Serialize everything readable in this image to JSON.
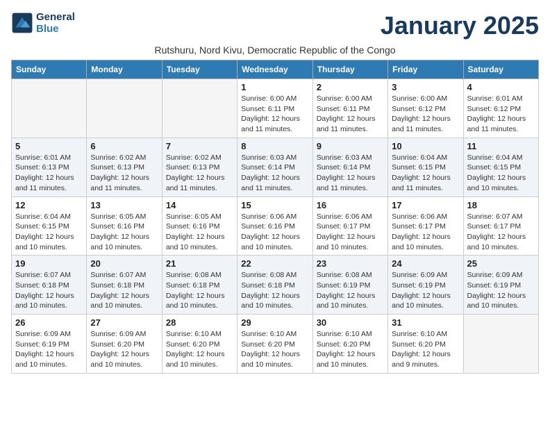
{
  "header": {
    "logo_line1": "General",
    "logo_line2": "Blue",
    "month": "January 2025",
    "subtitle": "Rutshuru, Nord Kivu, Democratic Republic of the Congo"
  },
  "weekdays": [
    "Sunday",
    "Monday",
    "Tuesday",
    "Wednesday",
    "Thursday",
    "Friday",
    "Saturday"
  ],
  "weeks": [
    [
      {
        "day": "",
        "info": ""
      },
      {
        "day": "",
        "info": ""
      },
      {
        "day": "",
        "info": ""
      },
      {
        "day": "1",
        "info": "Sunrise: 6:00 AM\nSunset: 6:11 PM\nDaylight: 12 hours and 11 minutes."
      },
      {
        "day": "2",
        "info": "Sunrise: 6:00 AM\nSunset: 6:11 PM\nDaylight: 12 hours and 11 minutes."
      },
      {
        "day": "3",
        "info": "Sunrise: 6:00 AM\nSunset: 6:12 PM\nDaylight: 12 hours and 11 minutes."
      },
      {
        "day": "4",
        "info": "Sunrise: 6:01 AM\nSunset: 6:12 PM\nDaylight: 12 hours and 11 minutes."
      }
    ],
    [
      {
        "day": "5",
        "info": "Sunrise: 6:01 AM\nSunset: 6:13 PM\nDaylight: 12 hours and 11 minutes."
      },
      {
        "day": "6",
        "info": "Sunrise: 6:02 AM\nSunset: 6:13 PM\nDaylight: 12 hours and 11 minutes."
      },
      {
        "day": "7",
        "info": "Sunrise: 6:02 AM\nSunset: 6:13 PM\nDaylight: 12 hours and 11 minutes."
      },
      {
        "day": "8",
        "info": "Sunrise: 6:03 AM\nSunset: 6:14 PM\nDaylight: 12 hours and 11 minutes."
      },
      {
        "day": "9",
        "info": "Sunrise: 6:03 AM\nSunset: 6:14 PM\nDaylight: 12 hours and 11 minutes."
      },
      {
        "day": "10",
        "info": "Sunrise: 6:04 AM\nSunset: 6:15 PM\nDaylight: 12 hours and 11 minutes."
      },
      {
        "day": "11",
        "info": "Sunrise: 6:04 AM\nSunset: 6:15 PM\nDaylight: 12 hours and 10 minutes."
      }
    ],
    [
      {
        "day": "12",
        "info": "Sunrise: 6:04 AM\nSunset: 6:15 PM\nDaylight: 12 hours and 10 minutes."
      },
      {
        "day": "13",
        "info": "Sunrise: 6:05 AM\nSunset: 6:16 PM\nDaylight: 12 hours and 10 minutes."
      },
      {
        "day": "14",
        "info": "Sunrise: 6:05 AM\nSunset: 6:16 PM\nDaylight: 12 hours and 10 minutes."
      },
      {
        "day": "15",
        "info": "Sunrise: 6:06 AM\nSunset: 6:16 PM\nDaylight: 12 hours and 10 minutes."
      },
      {
        "day": "16",
        "info": "Sunrise: 6:06 AM\nSunset: 6:17 PM\nDaylight: 12 hours and 10 minutes."
      },
      {
        "day": "17",
        "info": "Sunrise: 6:06 AM\nSunset: 6:17 PM\nDaylight: 12 hours and 10 minutes."
      },
      {
        "day": "18",
        "info": "Sunrise: 6:07 AM\nSunset: 6:17 PM\nDaylight: 12 hours and 10 minutes."
      }
    ],
    [
      {
        "day": "19",
        "info": "Sunrise: 6:07 AM\nSunset: 6:18 PM\nDaylight: 12 hours and 10 minutes."
      },
      {
        "day": "20",
        "info": "Sunrise: 6:07 AM\nSunset: 6:18 PM\nDaylight: 12 hours and 10 minutes."
      },
      {
        "day": "21",
        "info": "Sunrise: 6:08 AM\nSunset: 6:18 PM\nDaylight: 12 hours and 10 minutes."
      },
      {
        "day": "22",
        "info": "Sunrise: 6:08 AM\nSunset: 6:18 PM\nDaylight: 12 hours and 10 minutes."
      },
      {
        "day": "23",
        "info": "Sunrise: 6:08 AM\nSunset: 6:19 PM\nDaylight: 12 hours and 10 minutes."
      },
      {
        "day": "24",
        "info": "Sunrise: 6:09 AM\nSunset: 6:19 PM\nDaylight: 12 hours and 10 minutes."
      },
      {
        "day": "25",
        "info": "Sunrise: 6:09 AM\nSunset: 6:19 PM\nDaylight: 12 hours and 10 minutes."
      }
    ],
    [
      {
        "day": "26",
        "info": "Sunrise: 6:09 AM\nSunset: 6:19 PM\nDaylight: 12 hours and 10 minutes."
      },
      {
        "day": "27",
        "info": "Sunrise: 6:09 AM\nSunset: 6:20 PM\nDaylight: 12 hours and 10 minutes."
      },
      {
        "day": "28",
        "info": "Sunrise: 6:10 AM\nSunset: 6:20 PM\nDaylight: 12 hours and 10 minutes."
      },
      {
        "day": "29",
        "info": "Sunrise: 6:10 AM\nSunset: 6:20 PM\nDaylight: 12 hours and 10 minutes."
      },
      {
        "day": "30",
        "info": "Sunrise: 6:10 AM\nSunset: 6:20 PM\nDaylight: 12 hours and 10 minutes."
      },
      {
        "day": "31",
        "info": "Sunrise: 6:10 AM\nSunset: 6:20 PM\nDaylight: 12 hours and 9 minutes."
      },
      {
        "day": "",
        "info": ""
      }
    ]
  ]
}
